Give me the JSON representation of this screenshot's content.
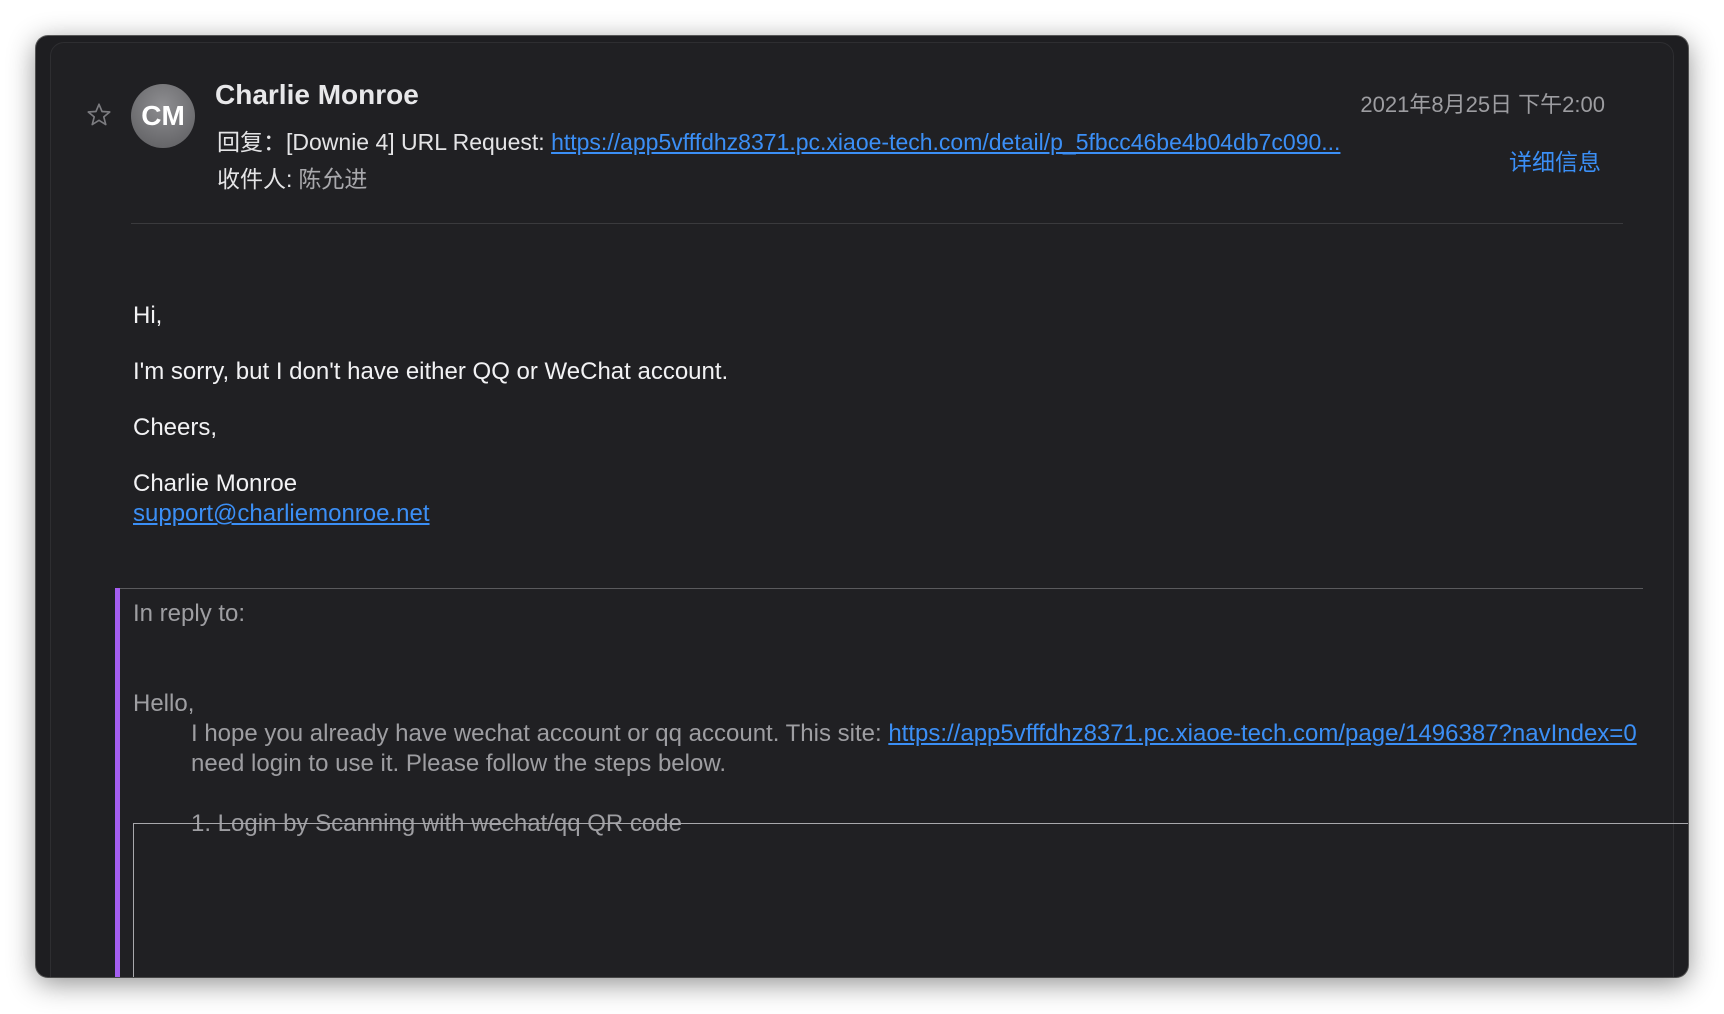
{
  "header": {
    "avatar_initials": "CM",
    "sender_name": "Charlie Monroe",
    "date": "2021年8月25日 下午2:00",
    "subject_prefix": "回复：[Downie 4] URL Request: ",
    "subject_link": "https://app5vfffdhz8371.pc.xiaoe-tech.com/detail/p_5fbcc46be4b04db7c090...",
    "recipient_label": "收件人:",
    "recipient_name": "陈允进",
    "details_label": "详细信息"
  },
  "body": {
    "greeting": "Hi,",
    "message": "I'm sorry, but I don't have either QQ or WeChat account.",
    "closing": "Cheers,",
    "signature_name": "Charlie Monroe",
    "signature_email": "support@charliemonroe.net"
  },
  "quote": {
    "in_reply_to": "In reply to:",
    "hello": "Hello,",
    "line_prefix": "I hope you already have wechat account or  qq account. This site: ",
    "site_link": "https://app5vfffdhz8371.pc.xiaoe-tech.com/page/1496387?navIndex=0",
    "line_suffix": " need login to use it. Please follow the steps below.",
    "step1": "1. Login by Scanning with wechat/qq QR code"
  },
  "colors": {
    "background": "#1e1e21",
    "link": "#3b8ff6",
    "quote_bar": "#a45ef0"
  },
  "icons": {
    "star": "star-icon"
  }
}
